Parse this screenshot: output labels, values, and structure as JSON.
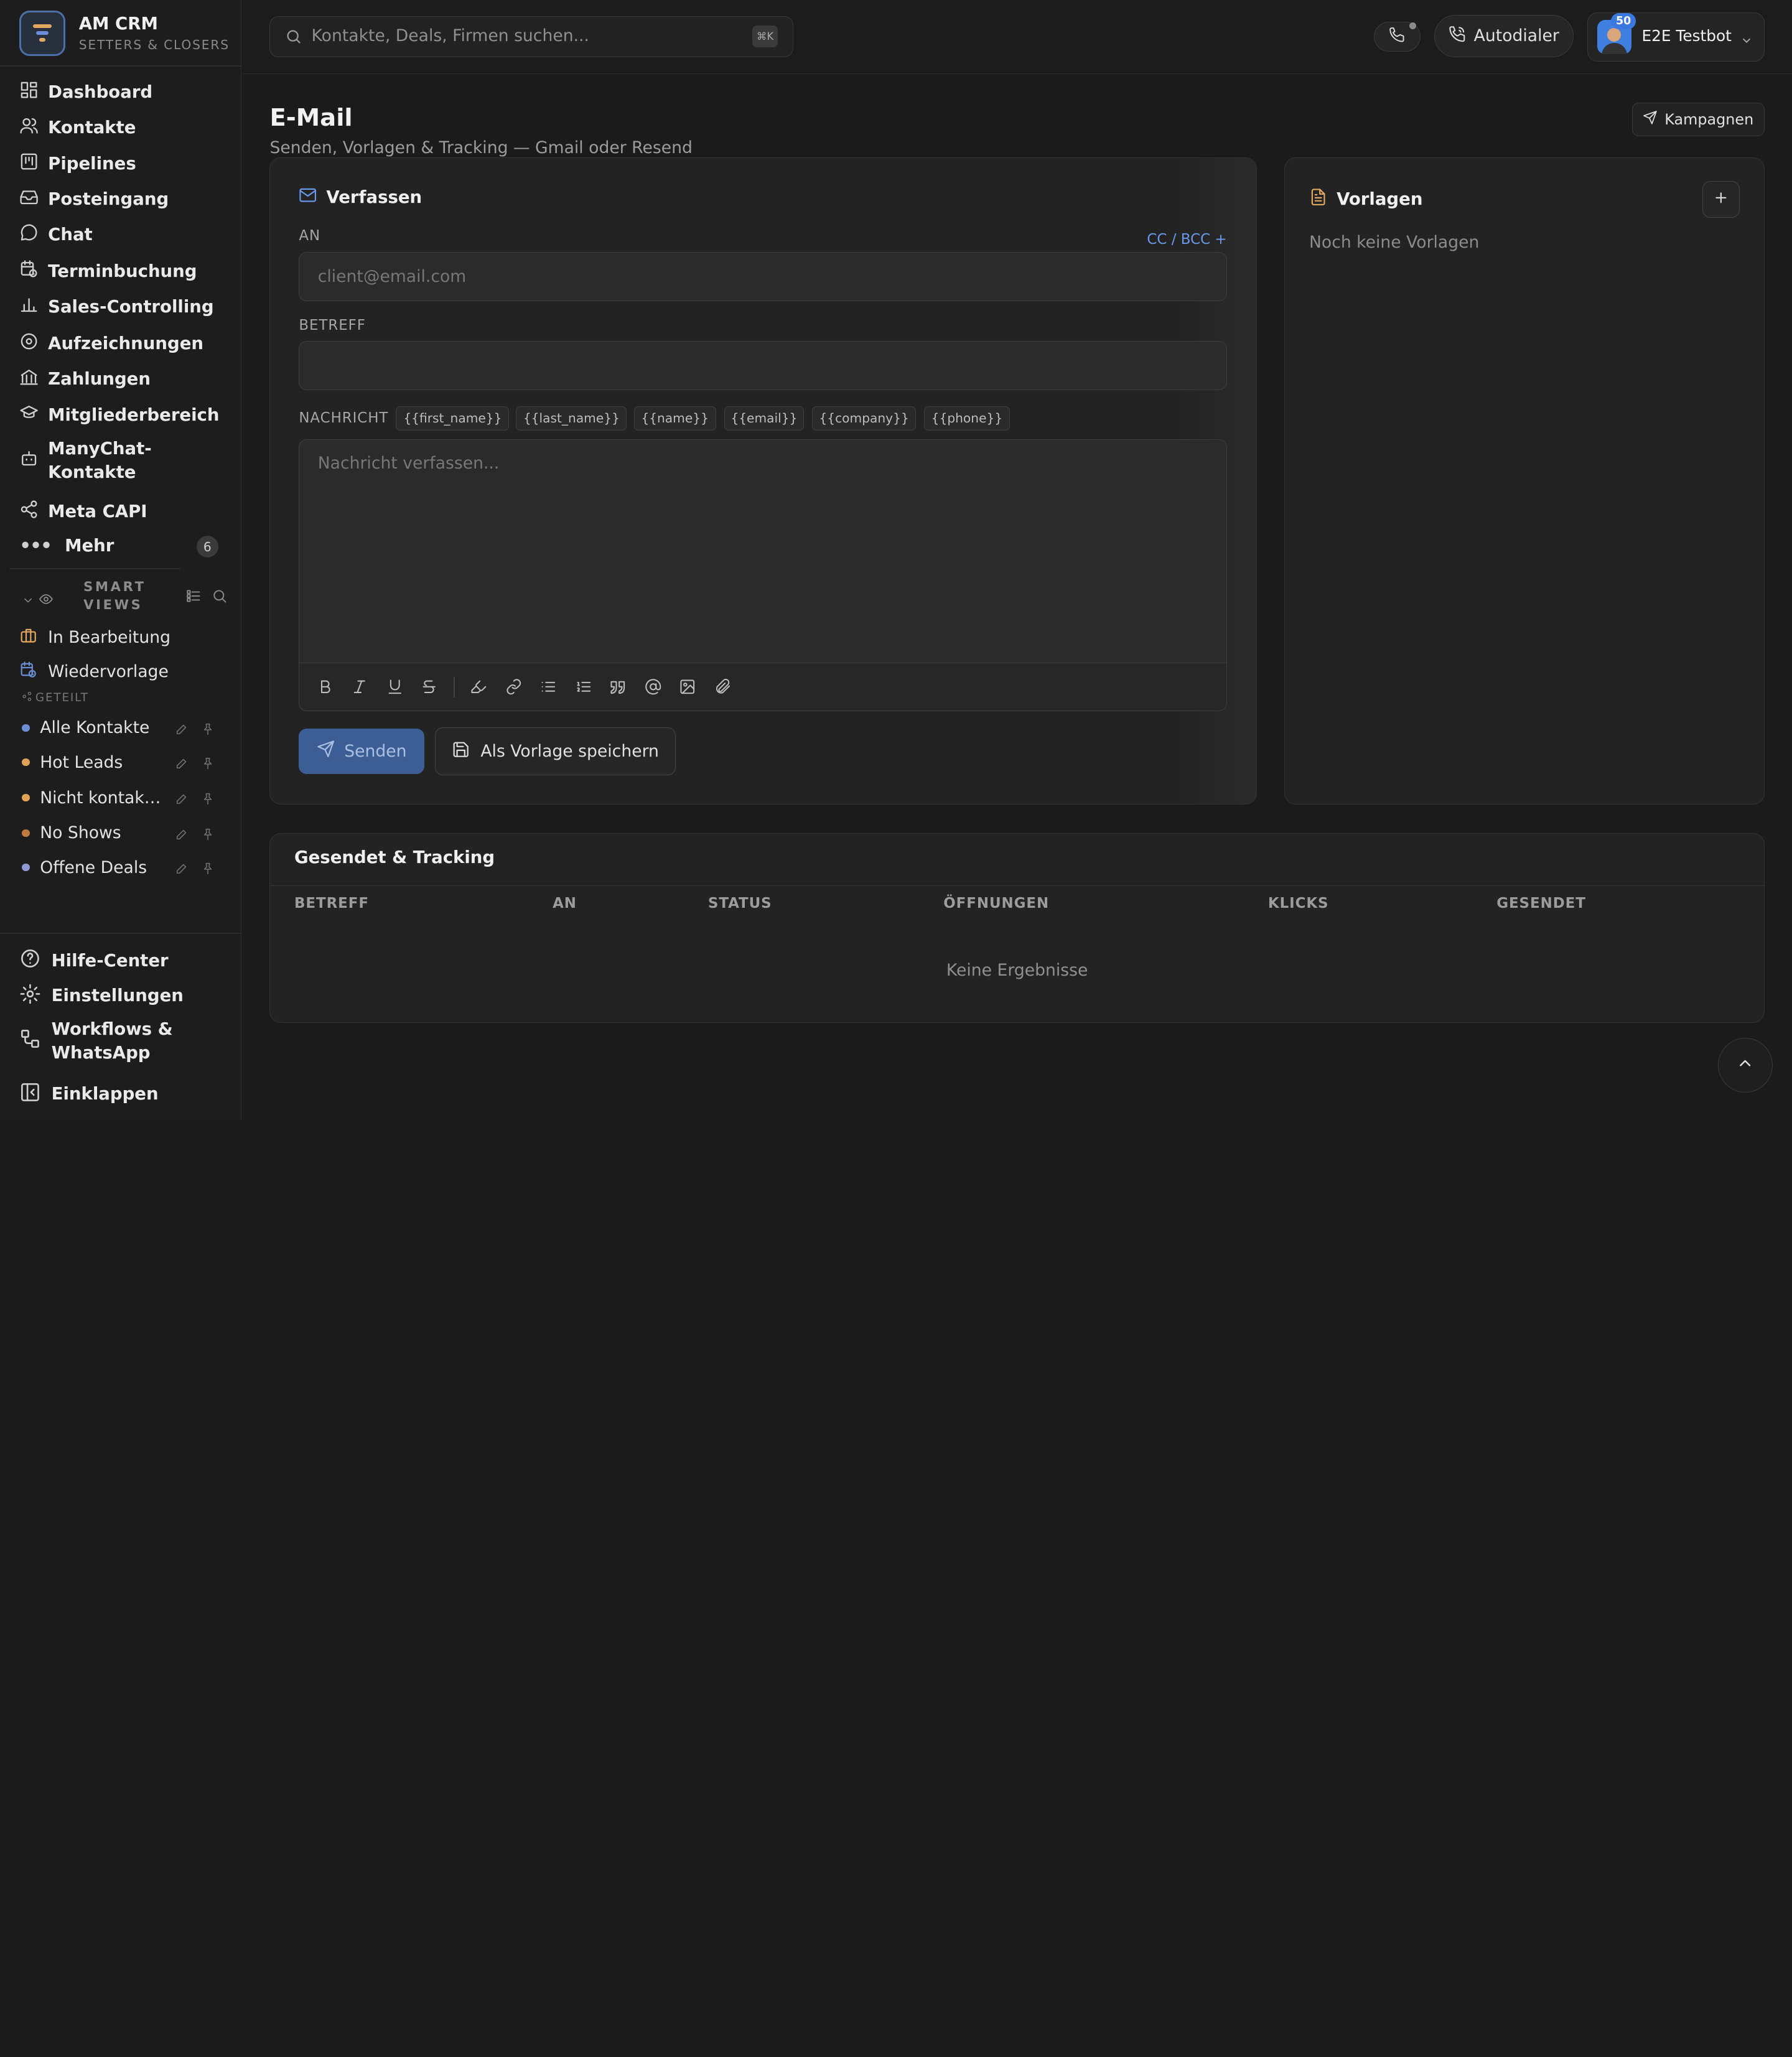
{
  "brand": {
    "name": "AM CRM",
    "subtitle": "SETTERS & CLOSERS"
  },
  "nav": [
    {
      "label": "Dashboard",
      "icon": "dashboard-icon"
    },
    {
      "label": "Kontakte",
      "icon": "users-icon"
    },
    {
      "label": "Pipelines",
      "icon": "pipeline-icon"
    },
    {
      "label": "Posteingang",
      "icon": "inbox-icon"
    },
    {
      "label": "Chat",
      "icon": "chat-icon"
    },
    {
      "label": "Terminbuchung",
      "icon": "calendar-clock-icon"
    },
    {
      "label": "Sales-Controlling",
      "icon": "bar-chart-icon"
    },
    {
      "label": "Aufzeichnungen",
      "icon": "record-icon"
    },
    {
      "label": "Zahlungen",
      "icon": "bank-icon"
    },
    {
      "label": "Mitgliederbereich",
      "icon": "graduation-cap-icon"
    },
    {
      "label": "ManyChat-Kontakte",
      "icon": "bot-icon"
    },
    {
      "label": "Meta CAPI",
      "icon": "share-icon"
    },
    {
      "label": "Mehr",
      "icon": "more-icon",
      "badge": "6"
    }
  ],
  "smart_views": {
    "title": "SMART VIEWS",
    "items": [
      {
        "label": "In Bearbeitung",
        "icon": "briefcase-icon"
      },
      {
        "label": "Wiedervorlage",
        "icon": "calendar-clock-icon"
      }
    ],
    "shared_label": "GETEILT",
    "shared": [
      {
        "label": "Alle Kontakte",
        "color": "#6b8ed6"
      },
      {
        "label": "Hot Leads",
        "color": "#e0a255"
      },
      {
        "label": "Nicht kontaktiert",
        "color": "#e0a255"
      },
      {
        "label": "No Shows",
        "color": "#c07a3e"
      },
      {
        "label": "Offene Deals",
        "color": "#8f9ad4"
      }
    ]
  },
  "sidebar_footer": [
    {
      "label": "Hilfe-Center",
      "icon": "help-circle-icon"
    },
    {
      "label": "Einstellungen",
      "icon": "settings-icon"
    },
    {
      "label": "Workflows & WhatsApp",
      "icon": "workflow-icon"
    },
    {
      "label": "Einklappen",
      "icon": "collapse-icon"
    }
  ],
  "topbar": {
    "search_placeholder": "Kontakte, Deals, Firmen suchen...",
    "search_shortcut": "⌘K",
    "autodialer_label": "Autodialer",
    "user_name": "E2E Testbot",
    "user_badge": "50"
  },
  "page": {
    "title": "E-Mail",
    "subtitle": "Senden, Vorlagen & Tracking — Gmail oder Resend",
    "campaigns_label": "Kampagnen"
  },
  "compose": {
    "title": "Verfassen",
    "to_label": "AN",
    "cc_bcc_label": "CC / BCC +",
    "to_placeholder": "client@email.com",
    "subject_label": "BETREFF",
    "message_label": "NACHRICHT",
    "variables": [
      "{{first_name}}",
      "{{last_name}}",
      "{{name}}",
      "{{email}}",
      "{{company}}",
      "{{phone}}"
    ],
    "message_placeholder": "Nachricht verfassen...",
    "send_label": "Senden",
    "save_template_label": "Als Vorlage speichern"
  },
  "templates": {
    "title": "Vorlagen",
    "empty": "Noch keine Vorlagen"
  },
  "tracking": {
    "title": "Gesendet & Tracking",
    "columns": [
      "BETREFF",
      "AN",
      "STATUS",
      "ÖFFNUNGEN",
      "KLICKS",
      "GESENDET"
    ],
    "empty": "Keine Ergebnisse"
  },
  "colors": {
    "accent": "#3d5e94",
    "link": "#6a98e8",
    "template_icon": "#e3a75f"
  }
}
